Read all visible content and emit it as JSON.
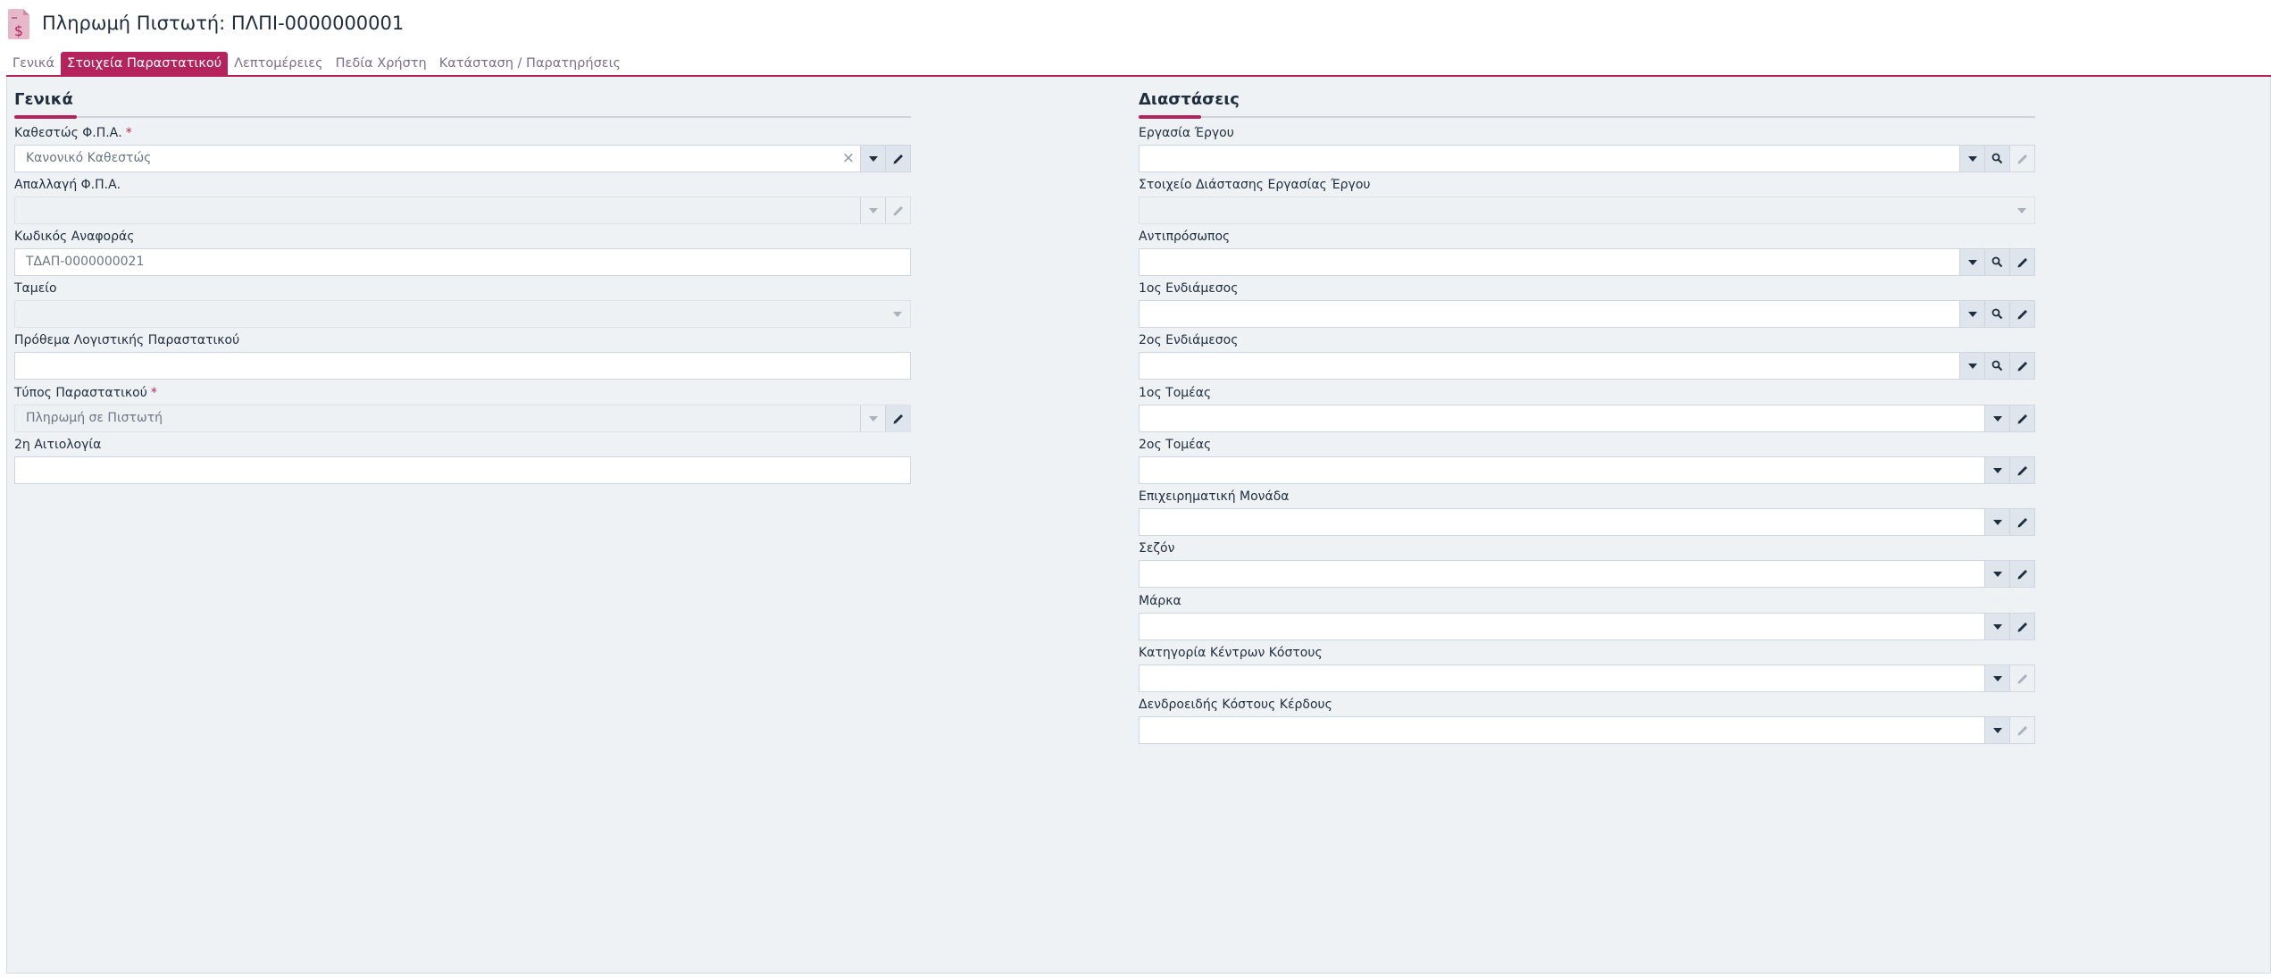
{
  "header": {
    "title": "Πληρωμή Πιστωτή: ΠΛΠΙ-0000000001",
    "icon": "document-dollar-icon"
  },
  "tabs": [
    {
      "label": "Γενικά",
      "active": false
    },
    {
      "label": "Στοιχεία Παραστατικού",
      "active": true
    },
    {
      "label": "Λεπτομέρειες",
      "active": false
    },
    {
      "label": "Πεδία Χρήστη",
      "active": false
    },
    {
      "label": "Κατάσταση / Παρατηρήσεις",
      "active": false
    }
  ],
  "colors": {
    "accent": "#b4235b",
    "panel": "#eff2f4"
  },
  "left_section": {
    "title": "Γενικά",
    "fields": [
      {
        "label": "Καθεστώς Φ.Π.Α.",
        "required": true,
        "value": "Κανονικό Καθεστώς"
      },
      {
        "label": "Απαλλαγή Φ.Π.Α.",
        "required": false,
        "value": ""
      },
      {
        "label": "Κωδικός Αναφοράς",
        "required": false,
        "value": "ΤΔΑΠ-0000000021"
      },
      {
        "label": "Ταμείο",
        "required": false,
        "value": ""
      },
      {
        "label": "Πρόθεμα Λογιστικής Παραστατικού",
        "required": false,
        "value": ""
      },
      {
        "label": "Τύπος Παραστατικού",
        "required": true,
        "value": "Πληρωμή σε Πιστωτή"
      },
      {
        "label": "2η Αιτιολογία",
        "required": false,
        "value": ""
      }
    ]
  },
  "right_section": {
    "title": "Διαστάσεις",
    "fields": [
      {
        "label": "Εργασία Έργου",
        "value": ""
      },
      {
        "label": "Στοιχείο Διάστασης Εργασίας Έργου",
        "value": ""
      },
      {
        "label": "Αντιπρόσωπος",
        "value": ""
      },
      {
        "label": "1ος Ενδιάμεσος",
        "value": ""
      },
      {
        "label": "2ος Ενδιάμεσος",
        "value": ""
      },
      {
        "label": "1ος Τομέας",
        "value": ""
      },
      {
        "label": "2ος Τομέας",
        "value": ""
      },
      {
        "label": "Επιχειρηματική Μονάδα",
        "value": ""
      },
      {
        "label": "Σεζόν",
        "value": ""
      },
      {
        "label": "Μάρκα",
        "value": ""
      },
      {
        "label": "Κατηγορία Κέντρων Κόστους",
        "value": ""
      },
      {
        "label": "Δενδροειδής Κόστους Κέρδους",
        "value": ""
      }
    ]
  }
}
